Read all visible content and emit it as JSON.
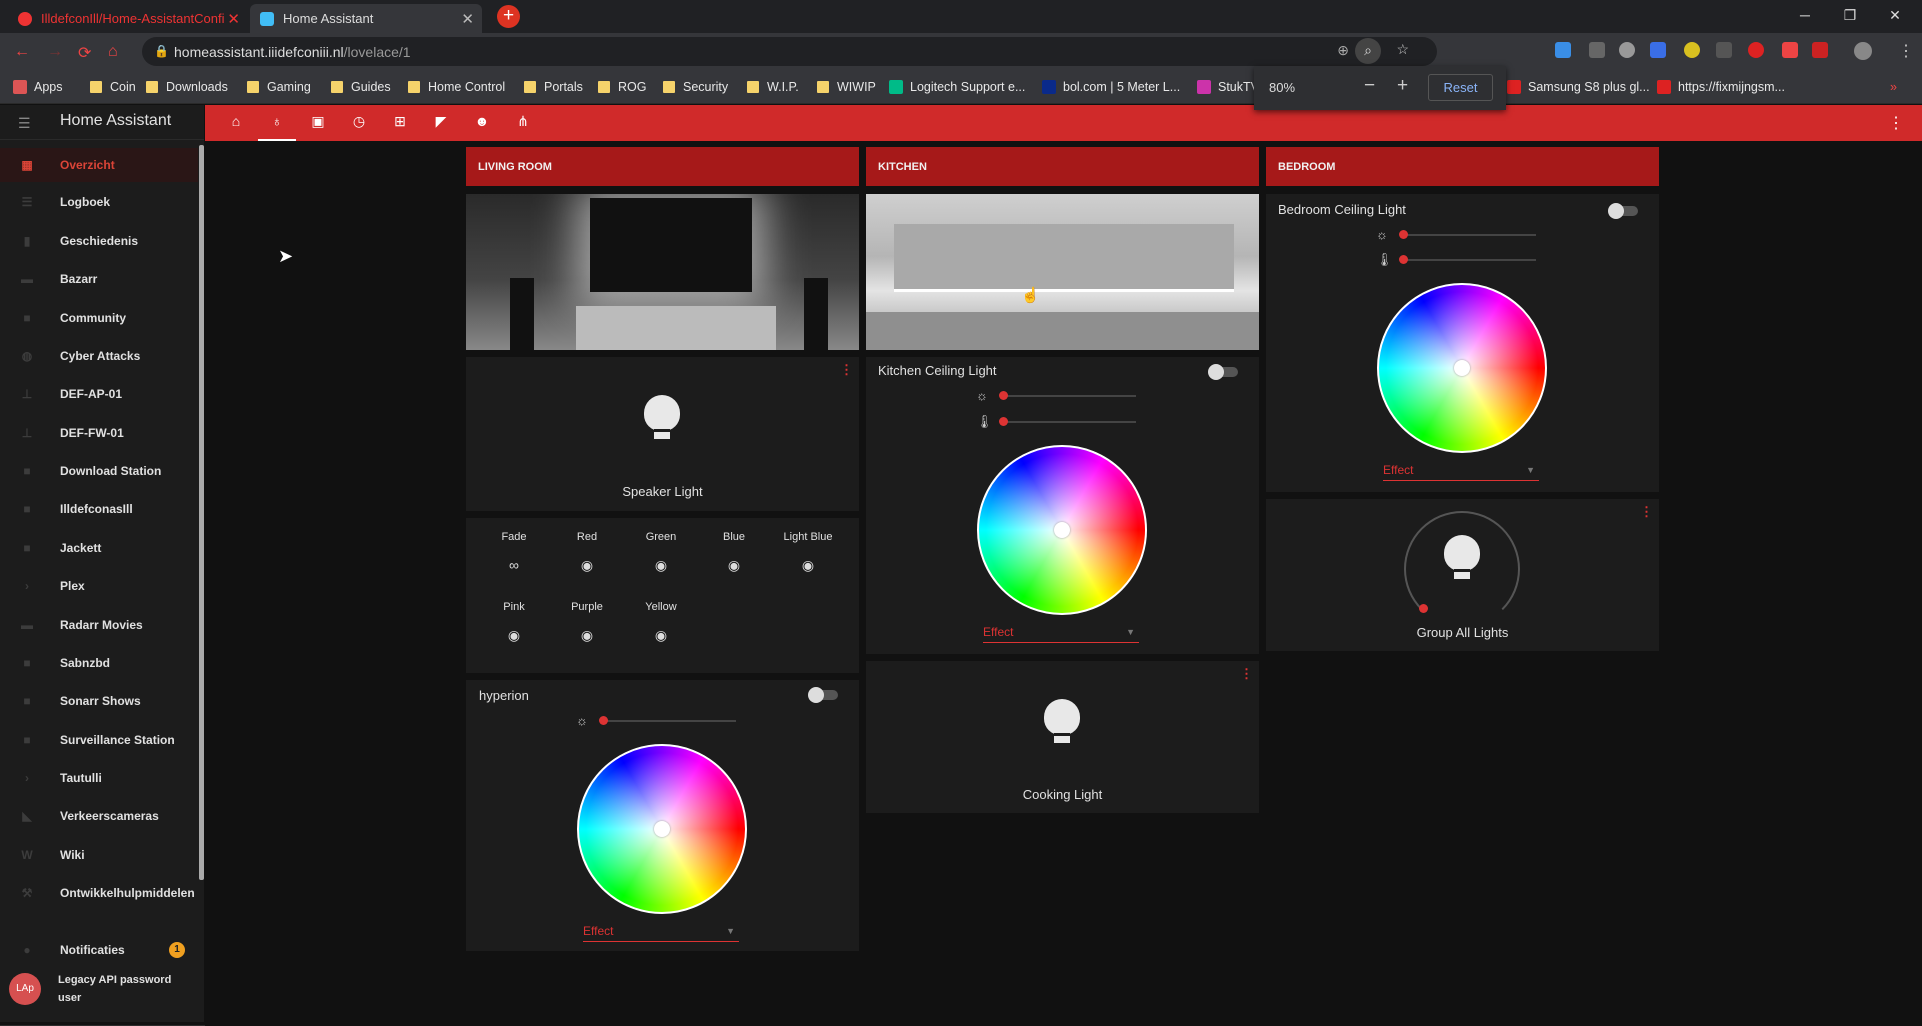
{
  "browser": {
    "tabs": [
      {
        "label": "IlldefconIll/Home-AssistantConfi"
      },
      {
        "label": "Home Assistant"
      }
    ],
    "url_host": "homeassistant.iiidefconiii.nl",
    "url_path": "/lovelace/1",
    "zoom": {
      "value": "80%",
      "reset_label": "Reset"
    },
    "bookmarks": [
      "Apps",
      "Coin",
      "Downloads",
      "Gaming",
      "Guides",
      "Home Control",
      "Portals",
      "ROG",
      "Security",
      "W.I.P.",
      "WIWIP",
      "Logitech Support e...",
      "bol.com | 5 Meter L...",
      "StukTV",
      "Samsung S8 plus gl...",
      "https://fixmijngsm..."
    ]
  },
  "sidebar": {
    "title": "Home Assistant",
    "items": [
      {
        "label": "Overzicht"
      },
      {
        "label": "Logboek"
      },
      {
        "label": "Geschiedenis"
      },
      {
        "label": "Bazarr"
      },
      {
        "label": "Community"
      },
      {
        "label": "Cyber Attacks"
      },
      {
        "label": "DEF-AP-01"
      },
      {
        "label": "DEF-FW-01"
      },
      {
        "label": "Download Station"
      },
      {
        "label": "IlldefconasIll"
      },
      {
        "label": "Jackett"
      },
      {
        "label": "Plex"
      },
      {
        "label": "Radarr Movies"
      },
      {
        "label": "Sabnzbd"
      },
      {
        "label": "Sonarr Shows"
      },
      {
        "label": "Surveillance Station"
      },
      {
        "label": "Tautulli"
      },
      {
        "label": "Verkeerscameras"
      },
      {
        "label": "Wiki"
      },
      {
        "label": "Ontwikkelhulpmiddelen"
      }
    ],
    "notifications": {
      "label": "Notificaties",
      "count": "1"
    },
    "user": {
      "initials": "LAp",
      "name_line1": "Legacy API password",
      "name_line2": "user"
    }
  },
  "columns": {
    "living_room": {
      "header": "LIVING ROOM",
      "speaker_light": "Speaker Light",
      "scenes": [
        "Fade",
        "Red",
        "Green",
        "Blue",
        "Light Blue",
        "Pink",
        "Purple",
        "Yellow"
      ],
      "hyperion": {
        "title": "hyperion",
        "effect": "Effect"
      }
    },
    "kitchen": {
      "header": "KITCHEN",
      "ceiling": {
        "title": "Kitchen Ceiling Light",
        "effect": "Effect"
      },
      "cooking_light": "Cooking Light"
    },
    "bedroom": {
      "header": "BEDROOM",
      "ceiling": {
        "title": "Bedroom Ceiling Light",
        "effect": "Effect"
      },
      "group": "Group All Lights"
    }
  },
  "colors": {
    "accent": "#d02a2a",
    "header_red": "#a61919",
    "card_bg": "#1c1c1c",
    "bg": "#111111"
  }
}
